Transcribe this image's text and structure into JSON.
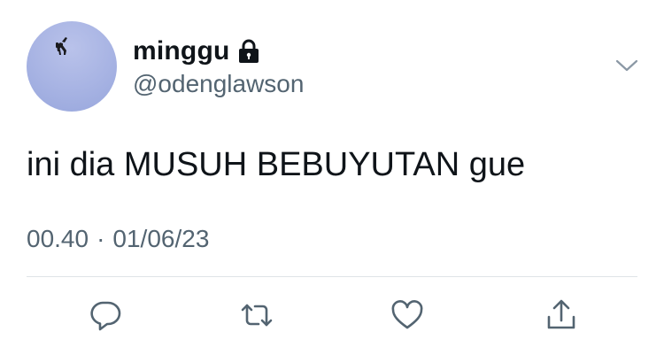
{
  "user": {
    "display_name": "minggu",
    "handle": "@odenglawson",
    "protected_icon": "lock-icon",
    "avatar_colors": [
      "#b9c2ea",
      "#97a6dc"
    ]
  },
  "tweet": {
    "text": "ini dia MUSUH BEBUYUTAN gue",
    "time": "00.40",
    "separator": "·",
    "date": "01/06/23"
  },
  "icons": {
    "more": "chevron-down-icon",
    "reply": "reply-icon",
    "retweet": "retweet-icon",
    "like": "heart-icon",
    "share": "share-icon"
  },
  "colors": {
    "primary_text": "#0f1419",
    "secondary_text": "#536471",
    "icon": "#536471",
    "divider": "#dfe3e7"
  }
}
